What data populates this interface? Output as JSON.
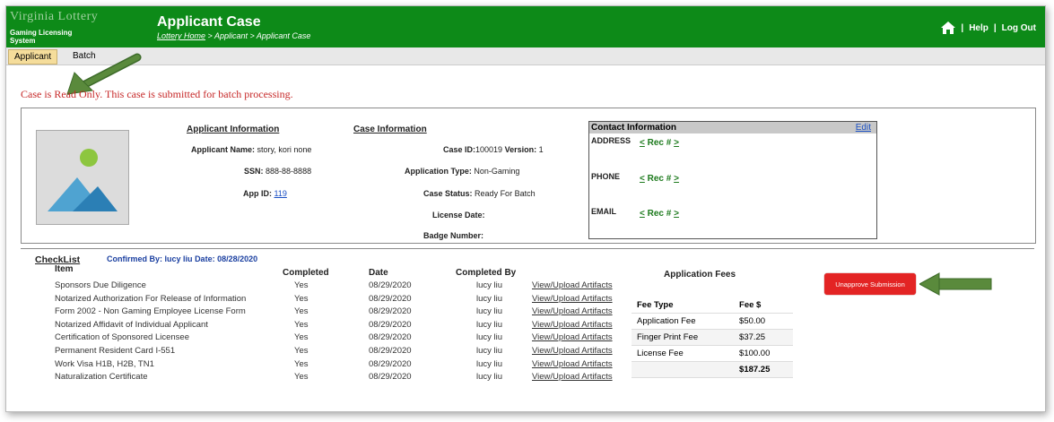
{
  "app": {
    "brand": "Virginia Lottery",
    "system_name": "Gaming Licensing System",
    "page_title": "Applicant Case",
    "breadcrumb_home": "Lottery Home",
    "breadcrumb_rest": " > Applicant > Applicant Case",
    "help": "Help",
    "separator": "|",
    "logout": "Log Out"
  },
  "tabs": [
    {
      "label": "Applicant"
    },
    {
      "label": "Batch"
    }
  ],
  "notice": "Case is Read Only. This case is submitted for batch processing.",
  "applicant_info": {
    "header": "Applicant Information",
    "name_label": "Applicant Name:",
    "name_value": "story, kori none",
    "ssn_label": "SSN:",
    "ssn_value": "888-88-8888",
    "appid_label": "App ID:",
    "appid_value": "119"
  },
  "case_info": {
    "header": "Case Information",
    "caseid_label": "Case ID:",
    "caseid_value": "100019",
    "version_label": "Version:",
    "version_value": "1",
    "apptype_label": "Application Type:",
    "apptype_value": "Non-Gaming",
    "status_label": "Case Status:",
    "status_value": "Ready For Batch",
    "license_label": "License Date:",
    "badge_label": "Badge Number:"
  },
  "contact": {
    "header": "Contact Information",
    "edit": "Edit",
    "address": "ADDRESS",
    "phone": "PHONE",
    "email": "EMAIL",
    "rec_prev": "<",
    "rec_label": "Rec #",
    "rec_next": ">"
  },
  "checklist": {
    "title": "CheckList",
    "confirmed_by_label": "Confirmed By:",
    "confirmed_by": "lucy liu",
    "date_label": "Date:",
    "date": "08/28/2020",
    "columns": [
      "Item",
      "Completed",
      "Date",
      "Completed By"
    ],
    "link_label": "View/Upload Artifacts",
    "rows": [
      {
        "item": "Sponsors Due Diligence",
        "completed": "Yes",
        "date": "08/29/2020",
        "by": "lucy liu"
      },
      {
        "item": "Notarized Authorization For Release of Information",
        "completed": "Yes",
        "date": "08/29/2020",
        "by": "lucy liu"
      },
      {
        "item": "Form 2002 - Non Gaming Employee License Form",
        "completed": "Yes",
        "date": "08/29/2020",
        "by": "lucy liu"
      },
      {
        "item": "Notarized Affidavit of Individual Applicant",
        "completed": "Yes",
        "date": "08/29/2020",
        "by": "lucy liu"
      },
      {
        "item": "Certification of Sponsored Licensee",
        "completed": "Yes",
        "date": "08/29/2020",
        "by": "lucy liu"
      },
      {
        "item": "Permanent Resident Card I-551",
        "completed": "Yes",
        "date": "08/29/2020",
        "by": "lucy liu"
      },
      {
        "item": "Work Visa H1B, H2B, TN1",
        "completed": "Yes",
        "date": "08/29/2020",
        "by": "lucy liu"
      },
      {
        "item": "Naturalization Certificate",
        "completed": "Yes",
        "date": "08/29/2020",
        "by": "lucy liu"
      }
    ]
  },
  "fees": {
    "title": "Application Fees",
    "col_type": "Fee Type",
    "col_amount": "Fee $",
    "rows": [
      {
        "type": "Application Fee",
        "amount": "$50.00"
      },
      {
        "type": "Finger Print Fee",
        "amount": "$37.25"
      },
      {
        "type": "License Fee",
        "amount": "$100.00"
      }
    ],
    "total": "$187.25"
  },
  "unapprove_button": "Unapprove Submission",
  "colors": {
    "header_green": "#0d8a18",
    "notice_red": "#c62828",
    "button_red": "#e32424",
    "arrow_green": "#5a8a3c"
  }
}
